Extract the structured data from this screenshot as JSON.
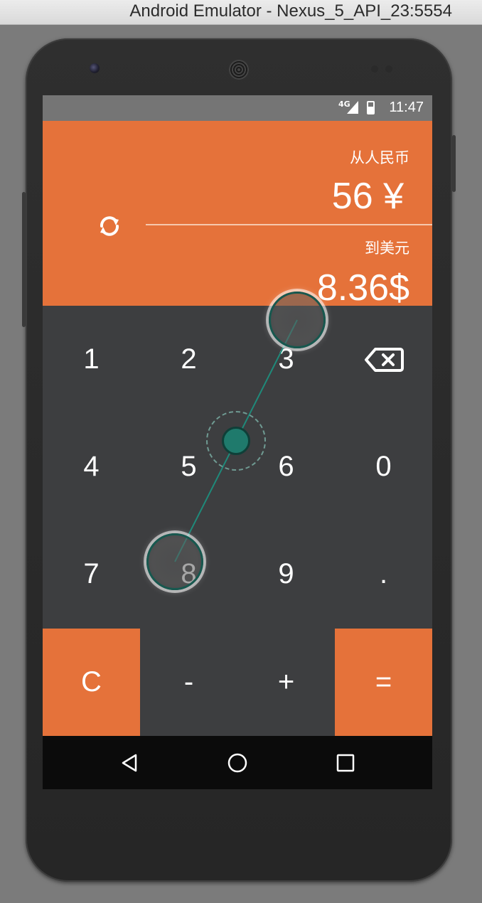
{
  "window": {
    "title": "Android Emulator - Nexus_5_API_23:5554"
  },
  "status_bar": {
    "network": "4G",
    "time": "11:47"
  },
  "converter": {
    "from_label": "从人民币",
    "from_value": "56 ¥",
    "to_label": "到美元",
    "to_value": "8.36$"
  },
  "keypad": {
    "rows": [
      [
        "1",
        "2",
        "3",
        "backspace"
      ],
      [
        "4",
        "5",
        "6",
        "0"
      ],
      [
        "7",
        "8",
        "9",
        "."
      ]
    ],
    "ops": [
      "C",
      "-",
      "+",
      "="
    ]
  },
  "navigation": {
    "buttons": [
      "back-icon",
      "home-icon",
      "recents-icon"
    ]
  },
  "colors": {
    "accent": "#e5723a",
    "keypad_bg": "#3d3e40",
    "status_bar": "#757575",
    "nav_bar": "#0b0b0b",
    "touch_indicator": "#1f7a6c"
  }
}
